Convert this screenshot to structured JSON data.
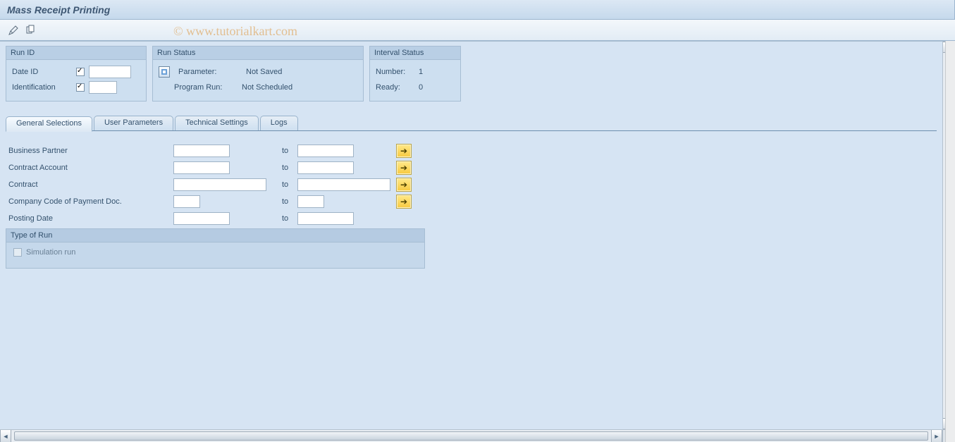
{
  "header": {
    "title": "Mass Receipt Printing"
  },
  "toolbar": {
    "tool1_tip": "Display/Change",
    "tool2_tip": "Copy"
  },
  "run_id": {
    "title": "Run ID",
    "date_id_label": "Date ID",
    "identification_label": "Identification"
  },
  "run_status": {
    "title": "Run Status",
    "param_label": "Parameter:",
    "param_value": "Not Saved",
    "progrun_label": "Program Run:",
    "progrun_value": "Not Scheduled"
  },
  "interval_status": {
    "title": "Interval Status",
    "number_label": "Number:",
    "number_value": "1",
    "ready_label": "Ready:",
    "ready_value": "0"
  },
  "tabs": {
    "t1": "General Selections",
    "t2": "User Parameters",
    "t3": "Technical Settings",
    "t4": "Logs"
  },
  "sel": {
    "bp": "Business Partner",
    "ca": "Contract Account",
    "co": "Contract",
    "cc": "Company Code of Payment Doc.",
    "pd": "Posting Date",
    "to": "to"
  },
  "type_of_run": {
    "title": "Type of Run",
    "sim": "Simulation run"
  },
  "watermark": "© www.tutorialkart.com"
}
